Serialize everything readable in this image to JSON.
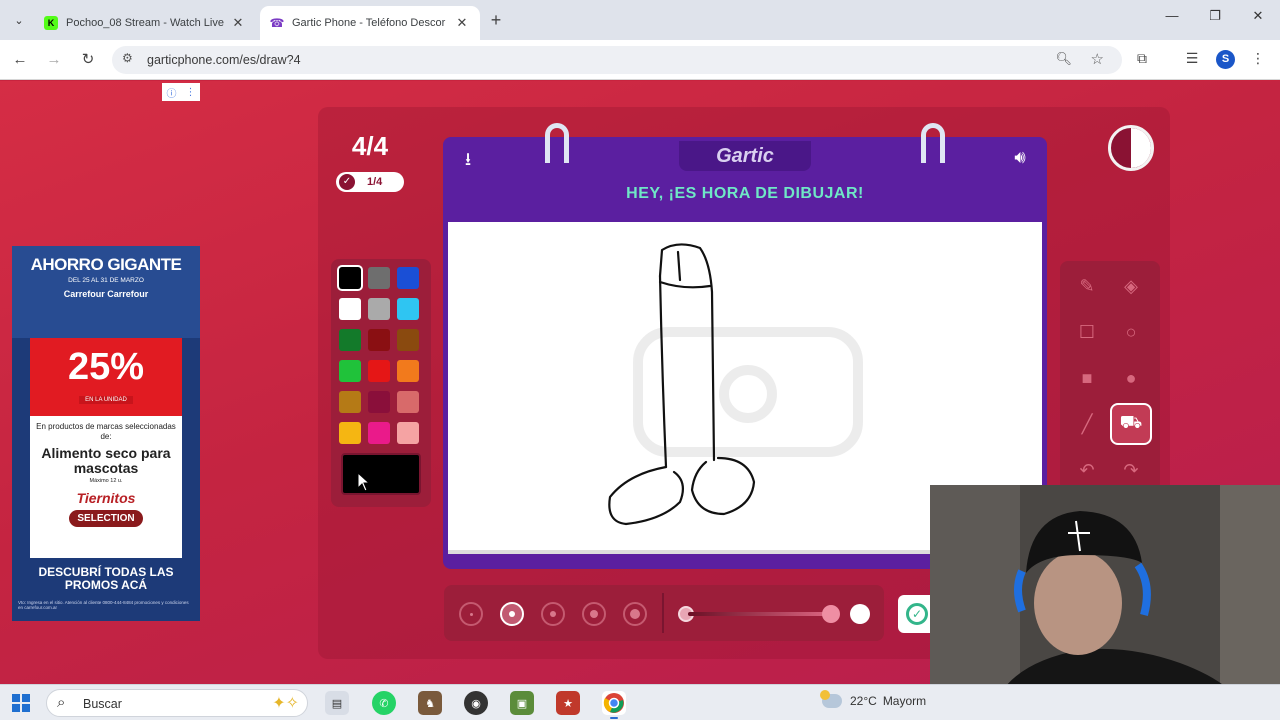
{
  "browser": {
    "tabs": [
      {
        "title": "Pochoo_08 Stream - Watch Live",
        "favicon": "K",
        "favicon_color": "#53fc18",
        "active": false
      },
      {
        "title": "Gartic Phone - Teléfono Descor",
        "favicon": "☎",
        "favicon_color": "#7b3bc4",
        "active": true
      }
    ],
    "url": "garticphone.com/es/draw?4",
    "profile_initial": "S"
  },
  "game": {
    "round": "4/4",
    "progress": "1/4",
    "logo": "Gartic",
    "headline": "HEY, ¡ES HORA DE DIBUJAR!",
    "palette": [
      [
        "#000000",
        "#6e6e6e",
        "#1a4fd6"
      ],
      [
        "#ffffff",
        "#aaaaaa",
        "#2fc5f2"
      ],
      [
        "#137a2a",
        "#8a0f12",
        "#8a4a0f"
      ],
      [
        "#20c23a",
        "#e51616",
        "#f27a1c"
      ],
      [
        "#b57a16",
        "#8a0f3a",
        "#d86a6a"
      ],
      [
        "#f5b612",
        "#ea1a8a",
        "#f5a3a3"
      ]
    ],
    "selected_color": "#000000",
    "tools": [
      "pencil-icon",
      "eraser-icon",
      "rectangle-outline-icon",
      "ellipse-outline-icon",
      "rectangle-filled-icon",
      "ellipse-filled-icon",
      "line-icon",
      "fill-bucket-icon",
      "undo-icon",
      "redo-icon"
    ],
    "active_tool": "fill-bucket-icon",
    "brush_sizes": 5,
    "active_brush_size": 2,
    "opacity_fraction": 0.95
  },
  "ad": {
    "headline": "AHORRO GIGANTE",
    "dates": "DEL 25 AL 31 DE MARZO",
    "stores": "Carrefour  Carrefour",
    "percent": "25%",
    "unit": "EN LA UNIDAD",
    "desc": "En productos de marcas seleccionadas de:",
    "product": "Alimento seco para mascotas",
    "limit": "Máximo 12 u.",
    "brand1": "Tiernitos",
    "brand2": "SELECTION",
    "cta": "DESCUBRÍ TODAS LAS PROMOS ACÁ",
    "legal": "Vto: Ingresa en el sitio. Atención al cliente 0800-444-8484 promociones y condiciones en carrefour.com.ar"
  },
  "taskbar": {
    "search_placeholder": "Buscar",
    "weather_temp": "22°C",
    "weather_text": "Mayorm"
  }
}
